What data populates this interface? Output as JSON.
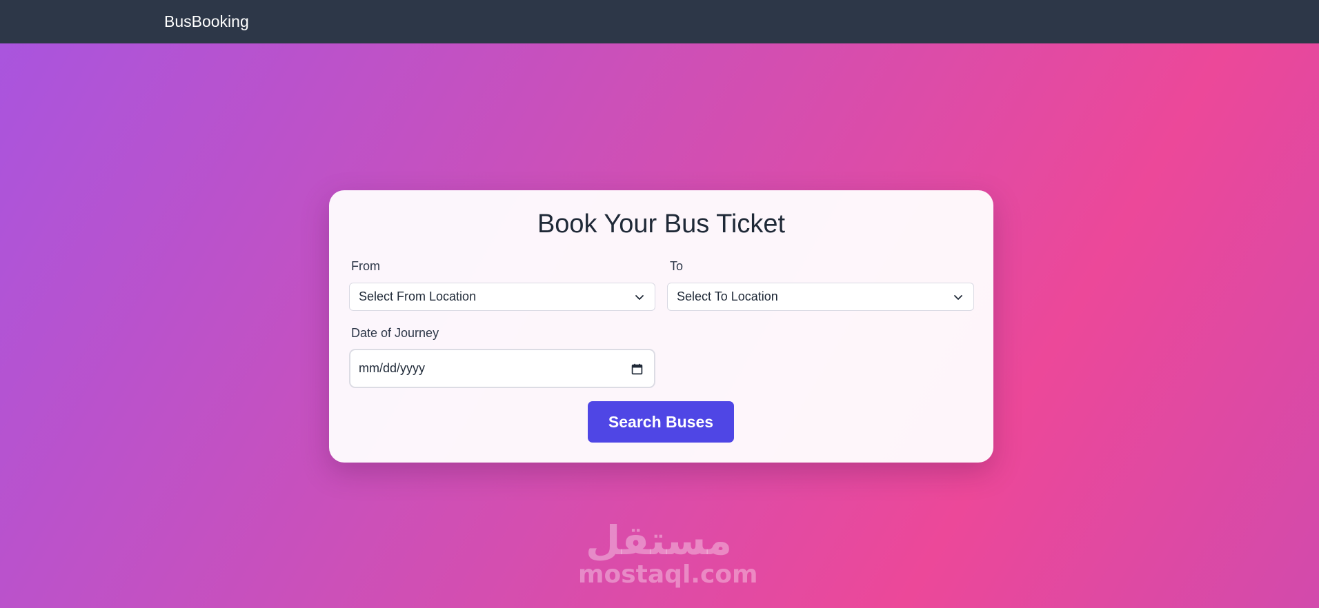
{
  "navbar": {
    "brand": "BusBooking"
  },
  "form": {
    "title": "Book Your Bus Ticket",
    "from_label": "From",
    "from_value": "Select From Location",
    "to_label": "To",
    "to_value": "Select To Location",
    "date_label": "Date of Journey",
    "date_placeholder": "mm/dd/yyyy",
    "search_button": "Search Buses"
  },
  "watermark": {
    "arabic": "مستقل",
    "latin": "mostaql.com"
  },
  "icons": {
    "select_arrow": "chevron-down-icon",
    "date_picker": "calendar-icon"
  },
  "colors": {
    "navbar": "#2d3748",
    "button": "#4f46e5",
    "gradient_start": "#a855df",
    "gradient_end": "#ec4899"
  }
}
